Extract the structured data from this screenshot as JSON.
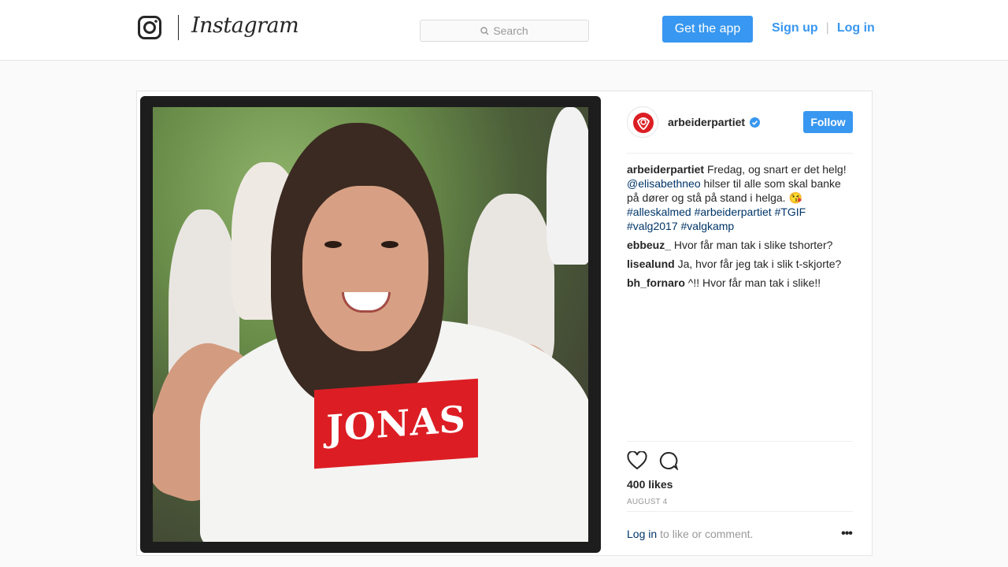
{
  "header": {
    "brand": "Instagram",
    "search_placeholder": "Search",
    "get_app": "Get the app",
    "sign_up": "Sign up",
    "log_in": "Log in",
    "separator": "|"
  },
  "post": {
    "image_shirt_text": "JONAS",
    "owner": {
      "username": "arbeiderpartiet",
      "verified": true,
      "follow_label": "Follow"
    },
    "caption": {
      "user": "arbeiderpartiet",
      "text_1": "Fredag, og snart er det helg!",
      "mention": "@elisabethneo",
      "text_2": "hilser til alle som skal banke på dører og stå på stand i helga. 😘",
      "hashtags": [
        "#alleskalmed",
        "#arbeiderpartiet",
        "#TGIF",
        "#valg2017",
        "#valgkamp"
      ]
    },
    "comments": [
      {
        "user": "ebbeuz_",
        "text": "Hvor får man tak i slike tshorter?"
      },
      {
        "user": "lisealund",
        "text": "Ja, hvor får jeg tak i slik t-skjorte?"
      },
      {
        "user": "bh_fornaro",
        "text": "^!! Hvor får man tak i slike!!"
      }
    ],
    "likes": "400 likes",
    "date": "AUGUST 4",
    "login_prompt": {
      "link": "Log in",
      "text": "to like or comment."
    },
    "more_label": "•••"
  },
  "colors": {
    "accent": "#3897f0",
    "link": "#003569",
    "brand_red": "#dc1e24"
  },
  "icons": [
    "instagram-glyph-icon",
    "search-icon",
    "verified-badge-icon",
    "heart-icon",
    "comment-icon",
    "more-options-icon"
  ]
}
